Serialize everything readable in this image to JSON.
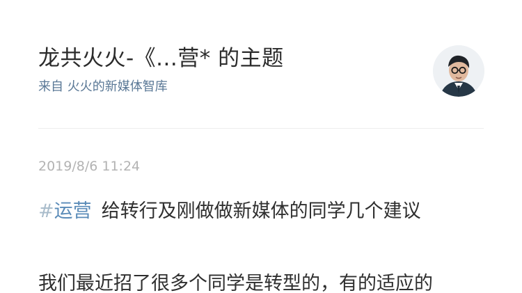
{
  "post": {
    "title": "龙共火火-《...营* 的主题",
    "source": "来自 火火的新媒体智库",
    "timestamp": "2019/8/6 11:24",
    "topic_hash": "#",
    "topic": "运营",
    "headline": "给转行及刚做做新媒体的同学几个建议",
    "body_first_line": "我们最近招了很多个同学是转型的，有的适应的"
  },
  "colors": {
    "title_text": "#2b2b2b",
    "source_link": "#5a7896",
    "timestamp": "#b3b3b3",
    "topic_link": "#5a8bb8",
    "hash": "#a9bccb",
    "body_text": "#2f2f2f"
  },
  "icons": {
    "avatar": "author-avatar"
  }
}
